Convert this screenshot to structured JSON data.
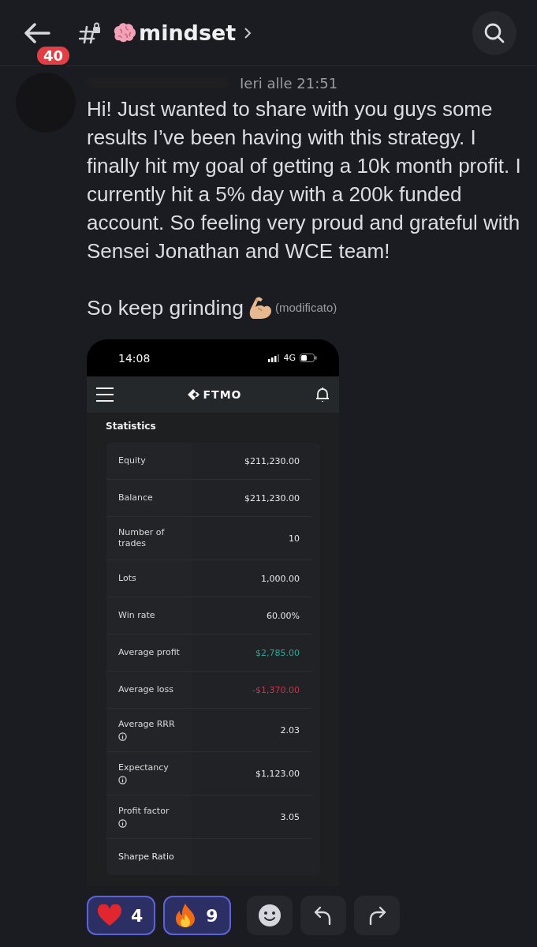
{
  "header": {
    "back_badge": "40",
    "channel": "mindset"
  },
  "message": {
    "timestamp": "Ieri alle 21:51",
    "text": "Hi! Just wanted to share with you guys some results I’ve been having with this strategy. I finally hit my goal of getting a 10k month profit. I currently hit a 5% day with a 200k funded account. So feeling very proud and grateful with Sensei Jonathan and WCE team!",
    "closing": "So keep grinding",
    "edited": "(modificato)"
  },
  "attachment": {
    "status_time": "14:08",
    "network": "4G",
    "brand": "FTMO",
    "section_title": "Statistics",
    "rows": [
      {
        "label": "Equity",
        "value": "$211,230.00",
        "info": false,
        "color": "#e4e4e4"
      },
      {
        "label": "Balance",
        "value": "$211,230.00",
        "info": false,
        "color": "#e4e4e4"
      },
      {
        "label": "Number of trades",
        "value": "10",
        "info": false,
        "color": "#e4e4e4"
      },
      {
        "label": "Lots",
        "value": "1,000.00",
        "info": false,
        "color": "#e4e4e4"
      },
      {
        "label": "Win rate",
        "value": "60.00%",
        "info": false,
        "color": "#e4e4e4"
      },
      {
        "label": "Average profit",
        "value": "$2,785.00",
        "info": false,
        "color": "#2aa89a"
      },
      {
        "label": "Average loss",
        "value": "-$1,370.00",
        "info": false,
        "color": "#c8364a"
      },
      {
        "label": "Average RRR",
        "value": "2.03",
        "info": true,
        "color": "#e4e4e4"
      },
      {
        "label": "Expectancy",
        "value": "$1,123.00",
        "info": true,
        "color": "#e4e4e4"
      },
      {
        "label": "Profit factor",
        "value": "3.05",
        "info": true,
        "color": "#e4e4e4"
      },
      {
        "label": "Sharpe Ratio",
        "info": false,
        "color": "#e4e4e4"
      }
    ]
  },
  "reactions": [
    {
      "kind": "heart",
      "count": "4",
      "selected": true
    },
    {
      "kind": "fire",
      "count": "9",
      "selected": true
    }
  ]
}
